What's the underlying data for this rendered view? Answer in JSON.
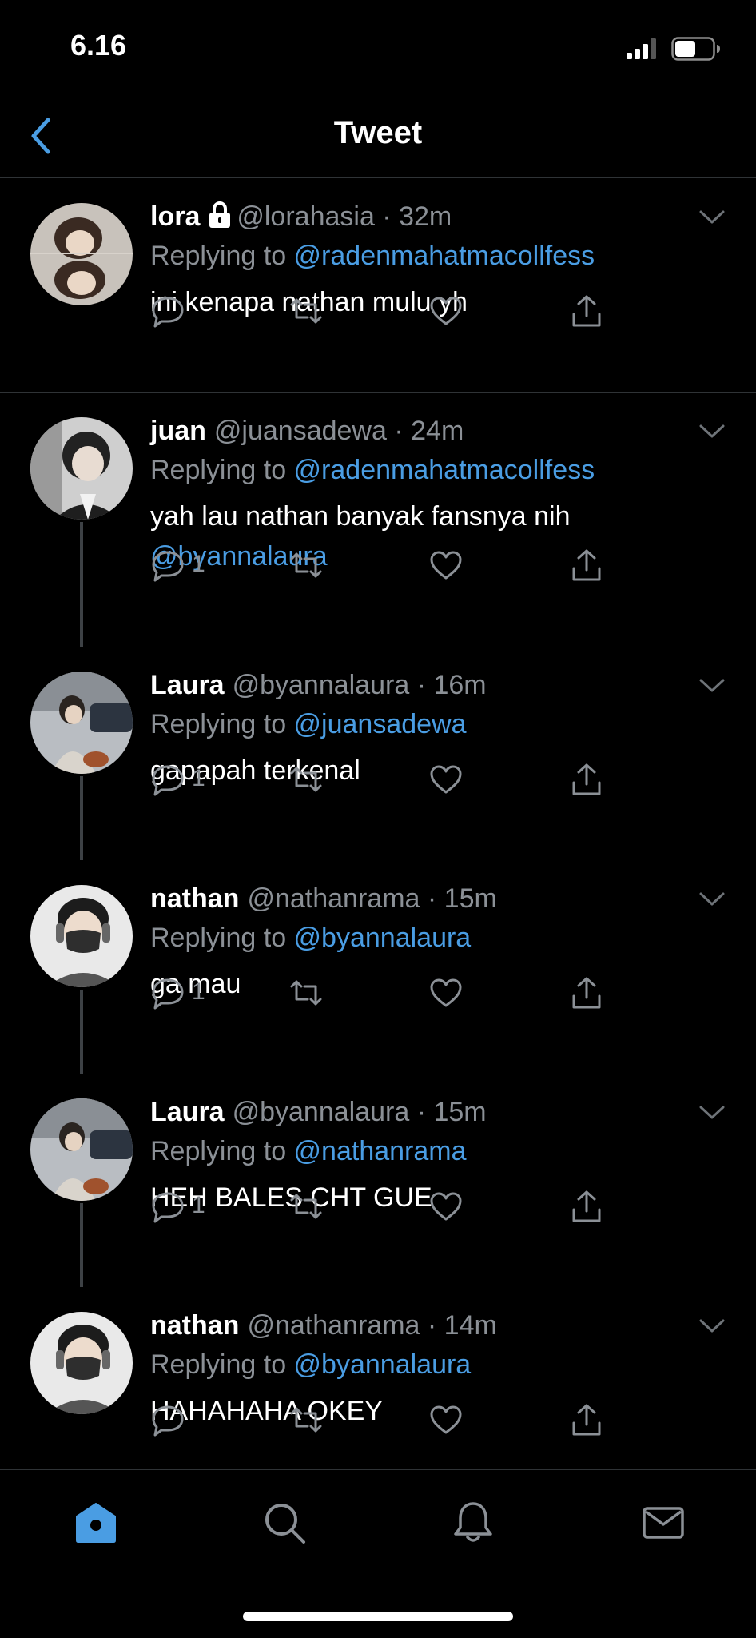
{
  "status_bar": {
    "time": "6.16",
    "battery_level": 0.55
  },
  "header": {
    "title": "Tweet"
  },
  "colors": {
    "accent": "#4a9de3",
    "muted": "#8b9096",
    "divider": "#2f3336",
    "background": "#000000"
  },
  "replying_label": "Replying to ",
  "tweets": [
    {
      "name": "lora",
      "locked": true,
      "handle": "@lorahasia",
      "time": "32m",
      "replying_to": "@radenmahatmacollfess",
      "text": "ini kenapa nathan mulu yh",
      "text_mention": "",
      "reply_count": ""
    },
    {
      "name": "juan",
      "handle": "@juansadewa",
      "time": "24m",
      "replying_to": "@radenmahatmacollfess",
      "text": "yah lau nathan banyak fansnya nih",
      "text_mention": "@byannalaura",
      "reply_count": "1"
    },
    {
      "name": "Laura",
      "handle": "@byannalaura",
      "time": "16m",
      "replying_to": "@juansadewa",
      "text": "gapapah terkenal",
      "text_mention": "",
      "reply_count": "1"
    },
    {
      "name": "nathan",
      "handle": "@nathanrama",
      "time": "15m",
      "replying_to": "@byannalaura",
      "text": "ga mau",
      "text_mention": "",
      "reply_count": "1"
    },
    {
      "name": "Laura",
      "handle": "@byannalaura",
      "time": "15m",
      "replying_to": "@nathanrama",
      "text": "HEH BALES CHT GUE",
      "text_mention": "",
      "reply_count": "1"
    },
    {
      "name": "nathan",
      "handle": "@nathanrama",
      "time": "14m",
      "replying_to": "@byannalaura",
      "text": "HAHAHAHA OKEY",
      "text_mention": "",
      "reply_count": ""
    }
  ],
  "tabbar": {
    "items": [
      {
        "icon": "home-icon",
        "active": true
      },
      {
        "icon": "search-icon",
        "active": false
      },
      {
        "icon": "bell-icon",
        "active": false
      },
      {
        "icon": "mail-icon",
        "active": false
      }
    ]
  }
}
